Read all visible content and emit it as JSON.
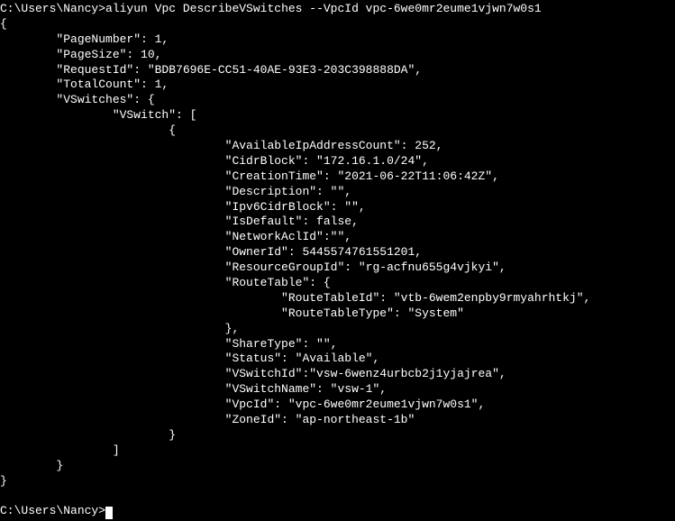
{
  "prompt1_path": "C:\\Users\\Nancy>",
  "command": "aliyun Vpc DescribeVSwitches --VpcId vpc-6we0mr2eume1vjwn7w0s1",
  "output": {
    "open_brace": "{",
    "line_pagenum": "        \"PageNumber\": 1,",
    "line_pagesize": "        \"PageSize\": 10,",
    "line_requestid": "        \"RequestId\": \"BDB7696E-CC51-40AE-93E3-203C398888DA\",",
    "line_totalcount": "        \"TotalCount\": 1,",
    "line_vswitches": "        \"VSwitches\": {",
    "line_vswitch_arr": "                \"VSwitch\": [",
    "line_obj_open": "                        {",
    "line_availip": "                                \"AvailableIpAddressCount\": 252,",
    "line_cidr": "                                \"CidrBlock\": \"172.16.1.0/24\",",
    "line_creation": "                                \"CreationTime\": \"2021-06-22T11:06:42Z\",",
    "line_desc": "                                \"Description\": \"\",",
    "line_ipv6": "                                \"Ipv6CidrBlock\": \"\",",
    "line_isdefault": "                                \"IsDefault\": false,",
    "line_netacl": "                                \"NetworkAclId\":\"\",",
    "line_owner": "                                \"OwnerId\": 5445574761551201,",
    "line_resgroup": "                                \"ResourceGroupId\": \"rg-acfnu655g4vjkyi\",",
    "line_rtable": "                                \"RouteTable\": {",
    "line_rtid": "                                        \"RouteTableId\": \"vtb-6wem2enpby9rmyahrhtkj\",",
    "line_rttype": "                                        \"RouteTableType\": \"System\"",
    "line_rt_close": "                                },",
    "line_share": "                                \"ShareType\": \"\",",
    "line_status": "                                \"Status\": \"Available\",",
    "line_vswid": "                                \"VSwitchId\":\"vsw-6wenz4urbcb2j1yjajrea\",",
    "line_vswname": "                                \"VSwitchName\": \"vsw-1\",",
    "line_vpcid": "                                \"VpcId\": \"vpc-6we0mr2eume1vjwn7w0s1\",",
    "line_zoneid": "                                \"ZoneId\": \"ap-northeast-1b\"",
    "line_obj_close": "                        }",
    "line_arr_close": "                ]",
    "line_vsw_close": "        }",
    "close_brace": "}"
  },
  "prompt2_path": "C:\\Users\\Nancy>",
  "chart_data": {
    "type": "table",
    "title": "DescribeVSwitches JSON response",
    "PageNumber": 1,
    "PageSize": 10,
    "RequestId": "BDB7696E-CC51-40AE-93E3-203C398888DA",
    "TotalCount": 1,
    "VSwitches": {
      "VSwitch": [
        {
          "AvailableIpAddressCount": 252,
          "CidrBlock": "172.16.1.0/24",
          "CreationTime": "2021-06-22T11:06:42Z",
          "Description": "",
          "Ipv6CidrBlock": "",
          "IsDefault": false,
          "NetworkAclId": "",
          "OwnerId": 5445574761551201,
          "ResourceGroupId": "rg-acfnu655g4vjkyi",
          "RouteTable": {
            "RouteTableId": "vtb-6wem2enpby9rmyahrhtkj",
            "RouteTableType": "System"
          },
          "ShareType": "",
          "Status": "Available",
          "VSwitchId": "vsw-6wenz4urbcb2j1yjajrea",
          "VSwitchName": "vsw-1",
          "VpcId": "vpc-6we0mr2eume1vjwn7w0s1",
          "ZoneId": "ap-northeast-1b"
        }
      ]
    }
  }
}
